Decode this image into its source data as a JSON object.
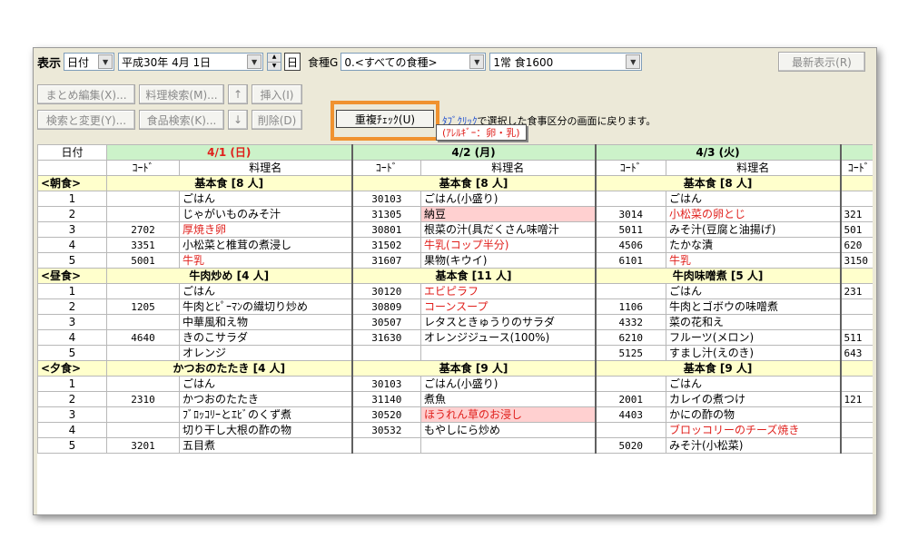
{
  "toolbar": {
    "display_label": "表示",
    "date_type": "日付",
    "date_value": "平成30年 4月 1日",
    "day_unit": "日",
    "food_group_label": "食種G",
    "food_group_value": "0.<すべての食種>",
    "diet_value": "1常 食1600",
    "latest_button": "最新表示(R)",
    "bulk_edit_button": "まとめ編集(X)...",
    "recipe_search_button": "料理検索(M)...",
    "up_button": "↑",
    "insert_button": "挿入(I)",
    "search_replace_button": "検索と変更(Y)...",
    "food_search_button": "食品検索(K)...",
    "down_button": "↓",
    "delete_button": "削除(D)",
    "duplicate_check_button": "重複ﾁｪｯｸ(U)",
    "hint_prefix": "ﾀﾌﾞｸﾘｯｸ",
    "hint_text": "で選択した食事区分の画面に戻ります。",
    "allergy_tooltip": "(ｱﾚﾙｷﾞｰ：卵・乳)"
  },
  "grid": {
    "date_header": "日付",
    "code_header": "ｺｰﾄﾞ",
    "dish_header": "料理名",
    "days": [
      "4/1 (日)",
      "4/2 (月)",
      "4/3 (火)"
    ],
    "sections": [
      {
        "name": "<朝食>",
        "menus": [
          "基本食 [8 人]",
          "基本食 [8 人]",
          "基本食 [8 人]"
        ],
        "rows": [
          {
            "no": "1",
            "cells": [
              [
                "",
                "ごはん"
              ],
              [
                "30103",
                "ごはん(小盛り)"
              ],
              [
                "",
                "ごはん"
              ]
            ],
            "c4": ""
          },
          {
            "no": "2",
            "cells": [
              [
                "",
                "じゃがいものみそ汁"
              ],
              [
                "31305",
                "納豆"
              ],
              [
                "3014",
                "小松菜の卵とじ"
              ]
            ],
            "c4": "321"
          },
          {
            "no": "3",
            "cells": [
              [
                "2702",
                "厚焼き卵"
              ],
              [
                "30801",
                "根菜の汁(具だくさん味噌汁"
              ],
              [
                "5011",
                "みそ汁(豆腐と油揚げ)"
              ]
            ],
            "c4": "501"
          },
          {
            "no": "4",
            "cells": [
              [
                "3351",
                "小松菜と椎茸の煮浸し"
              ],
              [
                "31502",
                "牛乳(コップ半分)"
              ],
              [
                "4506",
                "たかな漬"
              ]
            ],
            "c4": "620"
          },
          {
            "no": "5",
            "cells": [
              [
                "5001",
                "牛乳"
              ],
              [
                "31607",
                "果物(キウイ)"
              ],
              [
                "6101",
                "牛乳"
              ]
            ],
            "c4": "3150"
          }
        ]
      },
      {
        "name": "<昼食>",
        "menus": [
          "牛肉炒め [4 人]",
          "基本食 [11 人]",
          "牛肉味噌煮 [5 人]"
        ],
        "rows": [
          {
            "no": "1",
            "cells": [
              [
                "",
                "ごはん"
              ],
              [
                "30120",
                "エビピラフ"
              ],
              [
                "",
                "ごはん"
              ]
            ],
            "c4": "231"
          },
          {
            "no": "2",
            "cells": [
              [
                "1205",
                "牛肉とﾋﾟｰﾏﾝの繊切り炒め"
              ],
              [
                "30809",
                "コーンスープ"
              ],
              [
                "1106",
                "牛肉とゴボウの味噌煮"
              ]
            ],
            "c4": ""
          },
          {
            "no": "3",
            "cells": [
              [
                "",
                "中華風和え物"
              ],
              [
                "30507",
                "レタスときゅうりのサラダ"
              ],
              [
                "4332",
                "菜の花和え"
              ]
            ],
            "c4": ""
          },
          {
            "no": "4",
            "cells": [
              [
                "4640",
                "きのこサラダ"
              ],
              [
                "31630",
                "オレンジジュース(100%)"
              ],
              [
                "6210",
                "フルーツ(メロン)"
              ]
            ],
            "c4": "511"
          },
          {
            "no": "5",
            "cells": [
              [
                "",
                "オレンジ"
              ],
              [
                "",
                ""
              ],
              [
                "5125",
                "すまし汁(えのき)"
              ]
            ],
            "c4": "643"
          }
        ]
      },
      {
        "name": "<夕食>",
        "menus": [
          "かつおのたたき [4 人]",
          "基本食 [9 人]",
          "基本食 [9 人]"
        ],
        "rows": [
          {
            "no": "1",
            "cells": [
              [
                "",
                "ごはん"
              ],
              [
                "30103",
                "ごはん(小盛り)"
              ],
              [
                "",
                "ごはん"
              ]
            ],
            "c4": ""
          },
          {
            "no": "2",
            "cells": [
              [
                "2310",
                "かつおのたたき"
              ],
              [
                "31140",
                "煮魚"
              ],
              [
                "2001",
                "カレイの煮つけ"
              ]
            ],
            "c4": "121"
          },
          {
            "no": "3",
            "cells": [
              [
                "",
                "ﾌﾞﾛｯｺﾘｰとｴﾋﾞのくず煮"
              ],
              [
                "30520",
                "ほうれん草のお浸し"
              ],
              [
                "4403",
                "かにの酢の物"
              ]
            ],
            "c4": ""
          },
          {
            "no": "4",
            "cells": [
              [
                "",
                "切り干し大根の酢の物"
              ],
              [
                "30532",
                "もやしにら炒め"
              ],
              [
                "",
                "ブロッコリーのチーズ焼き"
              ]
            ],
            "c4": ""
          },
          {
            "no": "5",
            "cells": [
              [
                "3201",
                "五目煮"
              ],
              [
                "",
                ""
              ],
              [
                "5020",
                "みそ汁(小松菜)"
              ]
            ],
            "c4": ""
          }
        ]
      }
    ],
    "red_items": [
      "厚焼き卵",
      "牛乳",
      "小松菜の卵とじ",
      "牛乳(コップ半分)",
      "エビピラフ",
      "コーンスープ",
      "ほうれん草のお浸し",
      "ブロッコリーのチーズ焼き"
    ],
    "pink_items": [
      "納豆",
      "ほうれん草のお浸し"
    ]
  },
  "colors": {
    "date_header_bg": "#ccf2c9",
    "section_bg": "#ffffcc",
    "allergen_text": "#e0201c",
    "duplicate_bg": "#ffd0d0",
    "highlight_border": "#f0922f"
  }
}
